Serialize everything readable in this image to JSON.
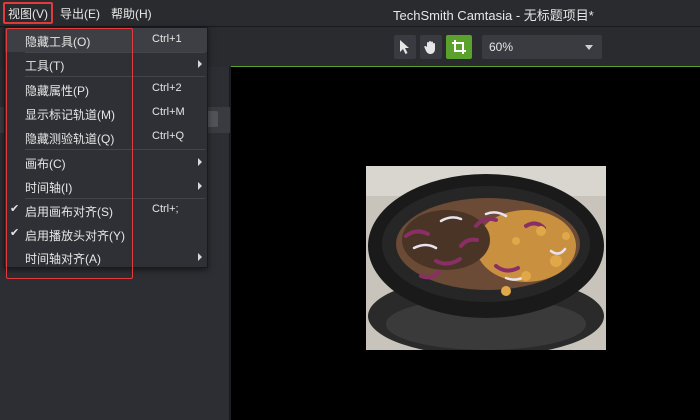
{
  "menubar": {
    "view": "视图(V)",
    "export": "导出(E)",
    "help": "帮助(H)"
  },
  "app_title": "TechSmith Camtasia - 无标题项目*",
  "toolbar": {
    "tools": [
      "pointer-icon",
      "hand-icon",
      "crop-icon"
    ],
    "zoom": "60%"
  },
  "view_menu": {
    "items": [
      {
        "label": "隐藏工具(O)",
        "shortcut": "Ctrl+1"
      },
      {
        "label": "工具(T)",
        "shortcut": ""
      },
      {
        "label": "隐藏属性(P)",
        "shortcut": "Ctrl+2"
      },
      {
        "label": "显示标记轨道(M)",
        "shortcut": "Ctrl+M"
      },
      {
        "label": "隐藏测验轨道(Q)",
        "shortcut": "Ctrl+Q"
      },
      {
        "label": "画布(C)",
        "shortcut": ""
      },
      {
        "label": "时间轴(I)",
        "shortcut": ""
      },
      {
        "label": "启用画布对齐(S)",
        "shortcut": "Ctrl+;"
      },
      {
        "label": "启用播放头对齐(Y)",
        "shortcut": ""
      },
      {
        "label": "时间轴对齐(A)",
        "shortcut": ""
      }
    ]
  },
  "colors": {
    "accent": "#5ba22c",
    "highlight": "#e23b3b",
    "panel": "#2d2e33"
  }
}
